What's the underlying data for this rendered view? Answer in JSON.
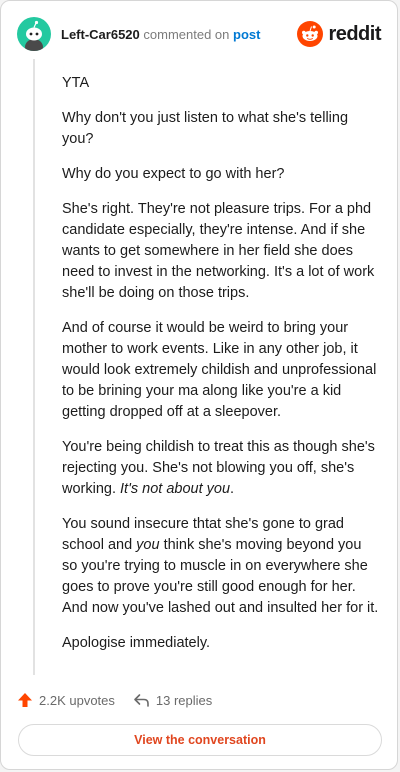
{
  "header": {
    "username": "Left-Car6520",
    "action_text": "commented on",
    "target_link": "post",
    "brand_name": "reddit",
    "avatar_icon": "snoo-avatar-icon",
    "brand_icon": "reddit-logo-icon"
  },
  "comment": {
    "p1": "YTA",
    "p2": "Why don't you just listen to what she's telling you?",
    "p3": "Why do you expect to go with her?",
    "p4": "She's right. They're not pleasure trips. For a phd candidate especially, they're intense. And if she wants to get somewhere in her field she does need to invest in the networking. It's a lot of work she'll be doing on those trips.",
    "p5": "And of course it would be weird to bring your mother to work events. Like in any other job, it would look extremely childish and unprofessional to be brining your ma along like you're a kid getting dropped off at a sleepover.",
    "p6_a": "You're being childish to treat this as though she's rejecting you. She's not blowing you off, she's working. ",
    "p6_em": "It's not about you",
    "p6_b": ".",
    "p7_a": "You sound insecure thtat she's gone to grad school and ",
    "p7_em": "you",
    "p7_b": " think she's moving beyond you so you're trying to muscle in on everywhere she goes to prove you're still good enough for her. And now you've lashed out and insulted her for it.",
    "p8": "Apologise immediately."
  },
  "footer": {
    "upvotes": "2.2K upvotes",
    "replies": "13 replies",
    "upvote_icon": "upvote-arrow-icon",
    "reply_icon": "reply-arrow-icon"
  },
  "cta": {
    "label": "View the conversation"
  },
  "colors": {
    "accent": "#ff4500",
    "link": "#0079d3",
    "avatar_bg": "#24c9a0",
    "cta_text": "#e0461f"
  }
}
